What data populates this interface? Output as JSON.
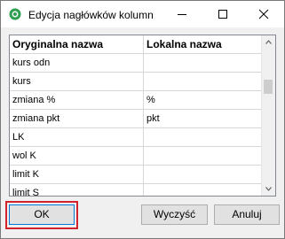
{
  "window": {
    "title": "Edycja nagłówków kolumn",
    "icon": "green-circle-app-icon",
    "controls": [
      "minimize-icon",
      "maximize-icon",
      "close-icon"
    ]
  },
  "table": {
    "columns": [
      "Oryginalna nazwa",
      "Lokalna nazwa"
    ],
    "rows": [
      [
        "kurs odn",
        ""
      ],
      [
        "kurs",
        ""
      ],
      [
        "zmiana %",
        "%"
      ],
      [
        "zmiana pkt",
        "pkt"
      ],
      [
        "LK",
        ""
      ],
      [
        "wol K",
        ""
      ],
      [
        "limit K",
        ""
      ],
      [
        "limit S",
        ""
      ]
    ]
  },
  "buttons": {
    "ok": "OK",
    "clear": "Wyczyść",
    "cancel": "Anuluj"
  },
  "colors": {
    "highlight_border": "#d2222d",
    "focus_border": "#0078d7",
    "app_icon": "#2e9e4f"
  }
}
